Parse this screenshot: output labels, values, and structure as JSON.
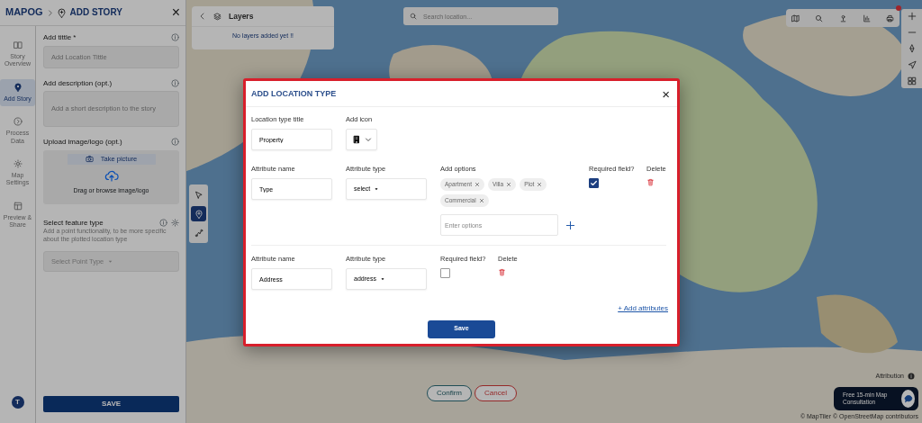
{
  "logo": {
    "text": "MAPOG"
  },
  "header": {
    "title": "ADD STORY",
    "close": "×"
  },
  "rail": [
    {
      "label": "Story Overview",
      "selected": false
    },
    {
      "label": "Add Story",
      "selected": true
    },
    {
      "label": "Process Data",
      "selected": false
    },
    {
      "label": "Map Settings",
      "selected": false
    },
    {
      "label": "Preview & Share",
      "selected": false
    }
  ],
  "avatar": "T",
  "form": {
    "title_label": "Add tittle *",
    "title_placeholder": "Add Location Tittle",
    "description_label": "Add description (opt.)",
    "description_placeholder": "Add a short description to the story",
    "upload_label": "Upload image/logo (opt.)",
    "take_picture": "Take picture",
    "drag_text": "Drag or browse image/logo",
    "feature_label": "Select feature type",
    "feature_help": "Add a point functionality, to be more specific about the plotted location type",
    "feature_select": "Select Point Type"
  },
  "save": "SAVE",
  "layers": {
    "title": "Layers",
    "empty": "No layers added yet !!"
  },
  "search": {
    "placeholder": "Search location..."
  },
  "draw_tools": [
    {
      "selected": false
    },
    {
      "selected": true
    },
    {
      "selected": false
    }
  ],
  "confirm": "Confirm",
  "cancel": "Cancel",
  "attribution": "Attribution",
  "consultation": "Free 15-min Map Consultation",
  "copyright": "© MapTiler © OpenStreetMap contributors",
  "modal": {
    "title": "ADD LOCATION TYPE",
    "close": "×",
    "location_type_label": "Location type title",
    "location_type_value": "Property",
    "icon_label": "Add icon",
    "attributes": [
      {
        "name_label": "Attribute name",
        "name_value": "Type",
        "type_label": "Attribute type",
        "type_value": "select",
        "options_label": "Add options",
        "options": [
          "Apartment",
          "Villa",
          "Plot",
          "Commercial"
        ],
        "options_placeholder": "Enter options",
        "required_label": "Required field?",
        "required": true,
        "delete_label": "Delete"
      },
      {
        "name_label": "Attribute name",
        "name_value": "Address",
        "type_label": "Attribute type",
        "type_value": "address",
        "required_label": "Required field?",
        "required": false,
        "delete_label": "Delete"
      }
    ],
    "add_attributes": "+ Add attributes",
    "save": "Save"
  }
}
